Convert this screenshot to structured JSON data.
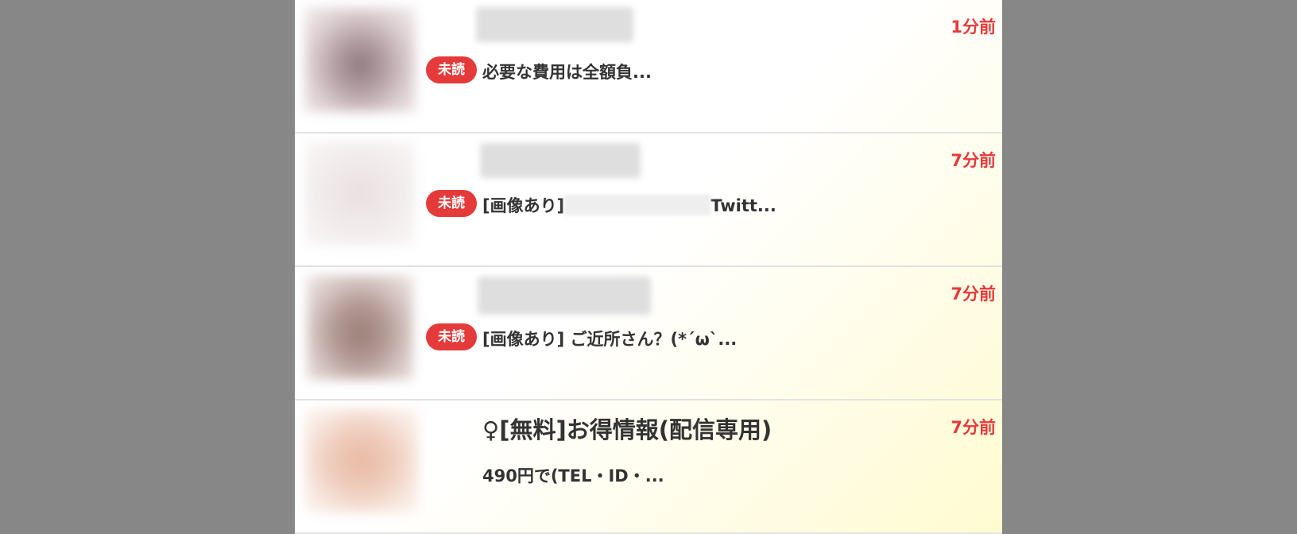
{
  "messages": [
    {
      "time": "1分前",
      "unread_label": "未読",
      "preview": "必要な費用は全額負..."
    },
    {
      "time": "7分前",
      "unread_label": "未読",
      "preview_prefix": "[画像あり]",
      "preview_suffix": "Twitt..."
    },
    {
      "time": "7分前",
      "unread_label": "未読",
      "preview": "[画像あり] ご近所さん？(*´ω`..."
    },
    {
      "name": "♀[無料]お得情報(配信専用)",
      "time": "7分前",
      "preview": "490円で(TEL・ID・..."
    }
  ],
  "colors": {
    "background": "#878787",
    "accent_red": "#e53a3a",
    "text": "#333333",
    "divider": "#e2e2e2"
  }
}
